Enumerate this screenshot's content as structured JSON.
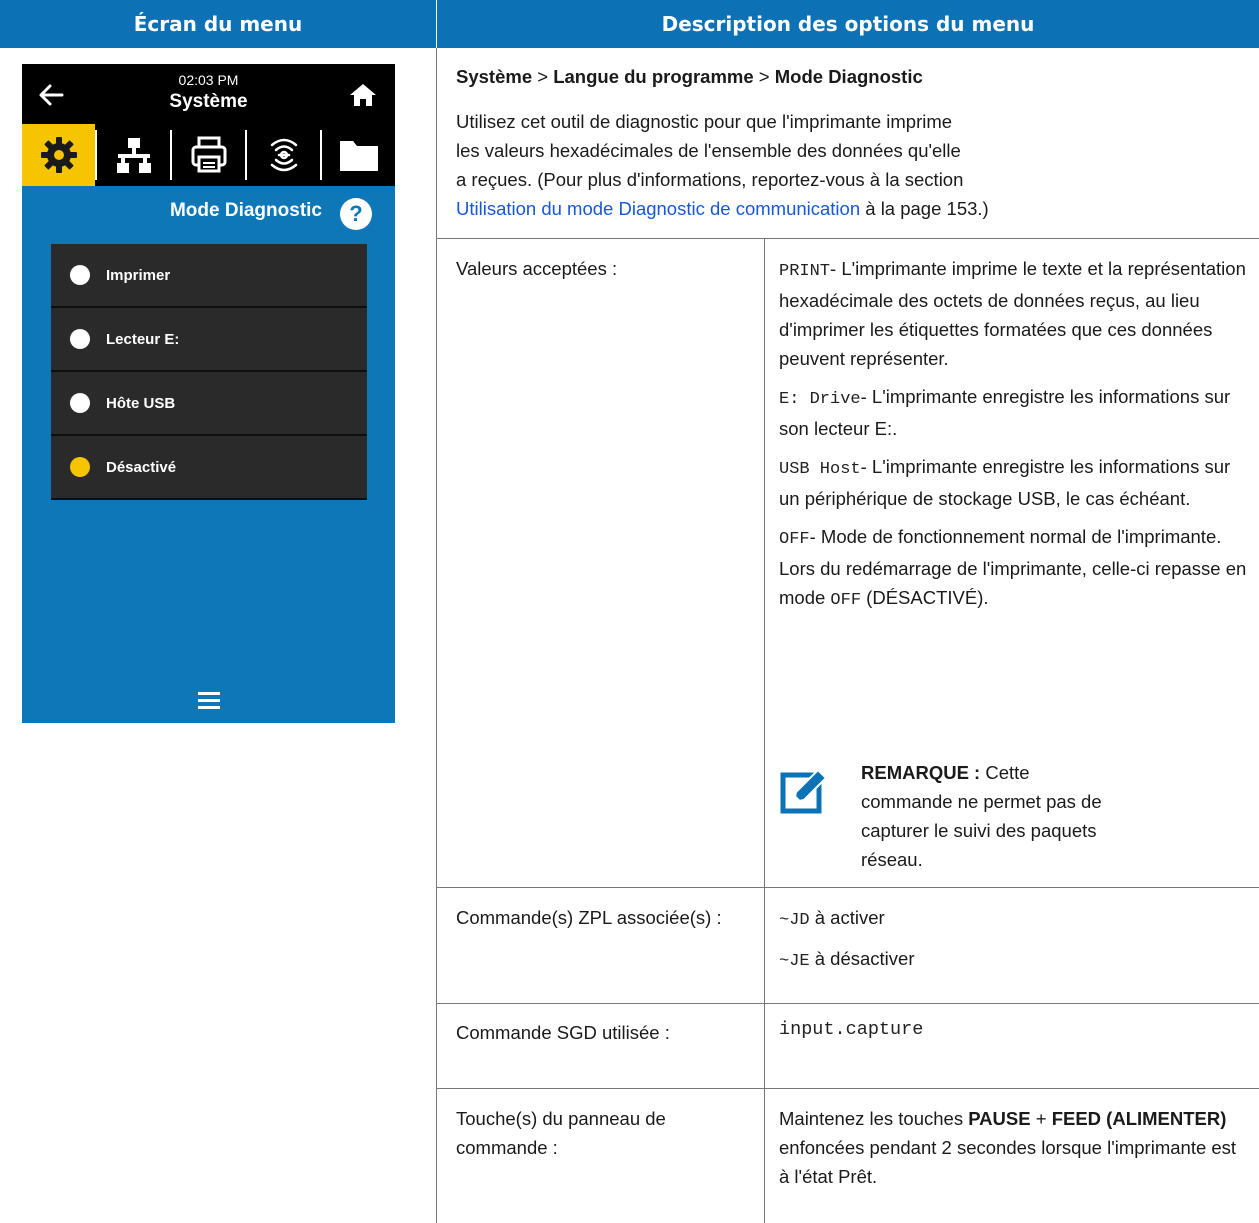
{
  "header": {
    "left": "Écran du menu",
    "right": "Description des options du menu"
  },
  "device": {
    "time": "02:03 PM",
    "title": "Système",
    "icons": [
      "back-arrow-icon",
      "home-icon",
      "gear-icon",
      "network-icon",
      "printer-icon",
      "wireless-icon",
      "folder-icon",
      "help-icon",
      "hamburger-menu-icon"
    ],
    "active_tab": "gear-icon",
    "subtitle": "Mode Diagnostic",
    "help": "?",
    "options": [
      {
        "label": "Imprimer",
        "selected": false
      },
      {
        "label": "Lecteur E:",
        "selected": false
      },
      {
        "label": "Hôte USB",
        "selected": false
      },
      {
        "label": "Désactivé",
        "selected": true
      }
    ],
    "colors": {
      "screen": "#0d77b7",
      "accent": "#f6c400",
      "bar": "#000000"
    }
  },
  "breadcrumb": {
    "a": "Système",
    "sep1": " > ",
    "b": "Langue du programme",
    "sep2": " > ",
    "c": "Mode Diagnostic"
  },
  "intro": {
    "line1": "Utilisez cet outil de diagnostic pour que l'imprimante imprime",
    "line2": "les valeurs hexadécimales de l'ensemble des données qu'elle",
    "line3": "a reçues. (Pour plus d'informations, reportez-vous à la section",
    "link": "Utilisation du mode Diagnostic de communication",
    "after_link": " à la page 153.)"
  },
  "rows": {
    "accepted": {
      "label": "Valeurs acceptées :",
      "print_code": "PRINT",
      "print_text": "- L'imprimante imprime le texte et la représentation hexadécimale des octets de données reçus, au lieu d'imprimer les étiquettes formatées que ces données peuvent représenter.",
      "edrive_code": "E: Drive",
      "edrive_text": "- L'imprimante enregistre les informations sur son lecteur E:.",
      "usb_code": "USB Host",
      "usb_text": "- L'imprimante enregistre les informations sur un périphérique de stockage USB, le cas échéant.",
      "off_code": "OFF",
      "off_text": "- Mode de fonctionnement normal de l'imprimante. Lors du redémarrage de l'imprimante, celle-ci repasse en mode ",
      "off_code2": "OFF",
      "off_tail": " (DÉSACTIVÉ).",
      "note_icon": "note-pencil-icon",
      "note_label": "REMARQUE :",
      "note_text": " Cette commande ne permet pas de capturer le suivi des paquets réseau."
    },
    "zpl": {
      "label": "Commande(s) ZPL associée(s) :",
      "cmd1": "~JD",
      "cmd1_text": " à activer",
      "cmd2": "~JE",
      "cmd2_text": " à désactiver"
    },
    "sgd": {
      "label": "Commande SGD utilisée :",
      "value": "input.capture"
    },
    "keys": {
      "label": "Touche(s) du panneau de commande :",
      "t1": "Maintenez les touches ",
      "k1": "PAUSE",
      "t2": " + ",
      "k2": "FEED (ALIMENTER)",
      "t3": " enfoncées pendant 2 secondes lorsque l'imprimante est à l'état Prêt."
    }
  }
}
